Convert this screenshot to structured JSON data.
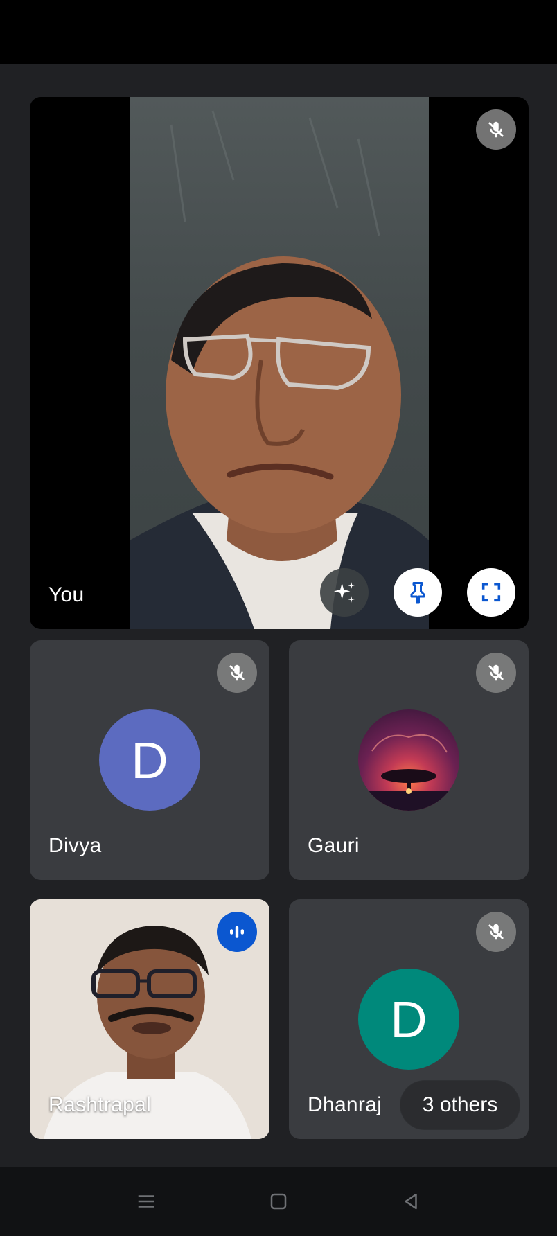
{
  "participants": {
    "self": {
      "name": "You"
    },
    "divya": {
      "name": "Divya",
      "initial": "D",
      "avatar_color": "#5c6bc0"
    },
    "gauri": {
      "name": "Gauri"
    },
    "rashtrapal": {
      "name": "Rashtrapal"
    },
    "dhanraj": {
      "name": "Dhanraj",
      "initial": "D",
      "avatar_color": "#00897b"
    }
  },
  "overflow": {
    "label": "3 others"
  },
  "icons": {
    "mic_off": "mic-off-icon",
    "speaking": "audio-level-icon",
    "effects": "sparkle-icon",
    "pin": "pin-icon",
    "fullscreen": "fullscreen-icon"
  },
  "colors": {
    "background": "#202124",
    "tile": "#3c4043",
    "accent_blue": "#0b57d0"
  }
}
